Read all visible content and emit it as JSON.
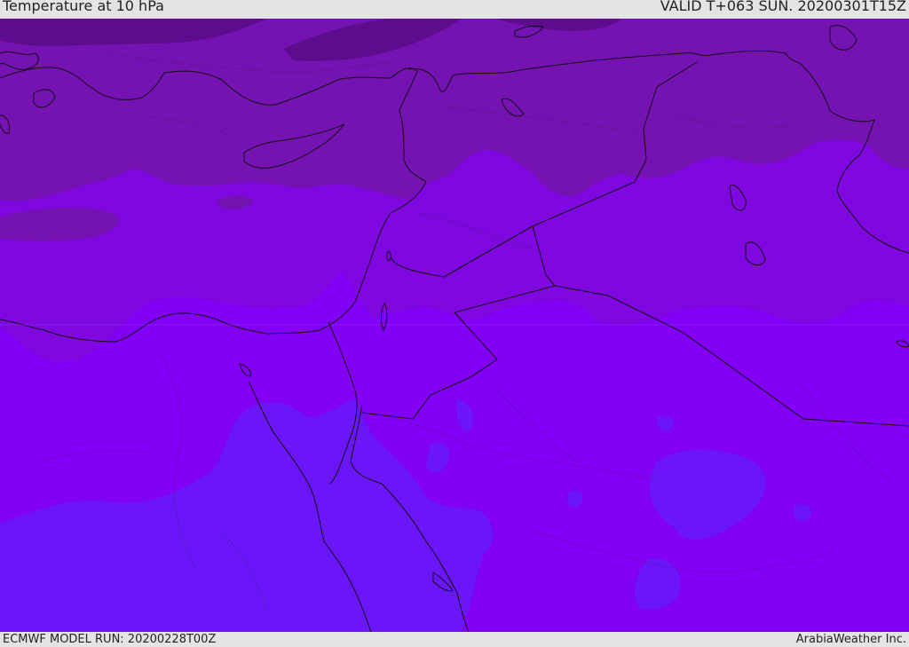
{
  "header": {
    "title": "Temperature at 10 hPa",
    "valid_time": "VALID T+063 SUN. 20200301T15Z"
  },
  "footer": {
    "model_run": "ECMWF MODEL RUN: 20200228T00Z",
    "credit": "ArabiaWeather Inc."
  },
  "colors": {
    "darkest_purple": "#5c0c8c",
    "dark_purple": "#7412b2",
    "mid_purple": "#7e08df",
    "violet": "#8100f5",
    "blue_violet": "#6a16f8",
    "border_line": "#111111"
  }
}
